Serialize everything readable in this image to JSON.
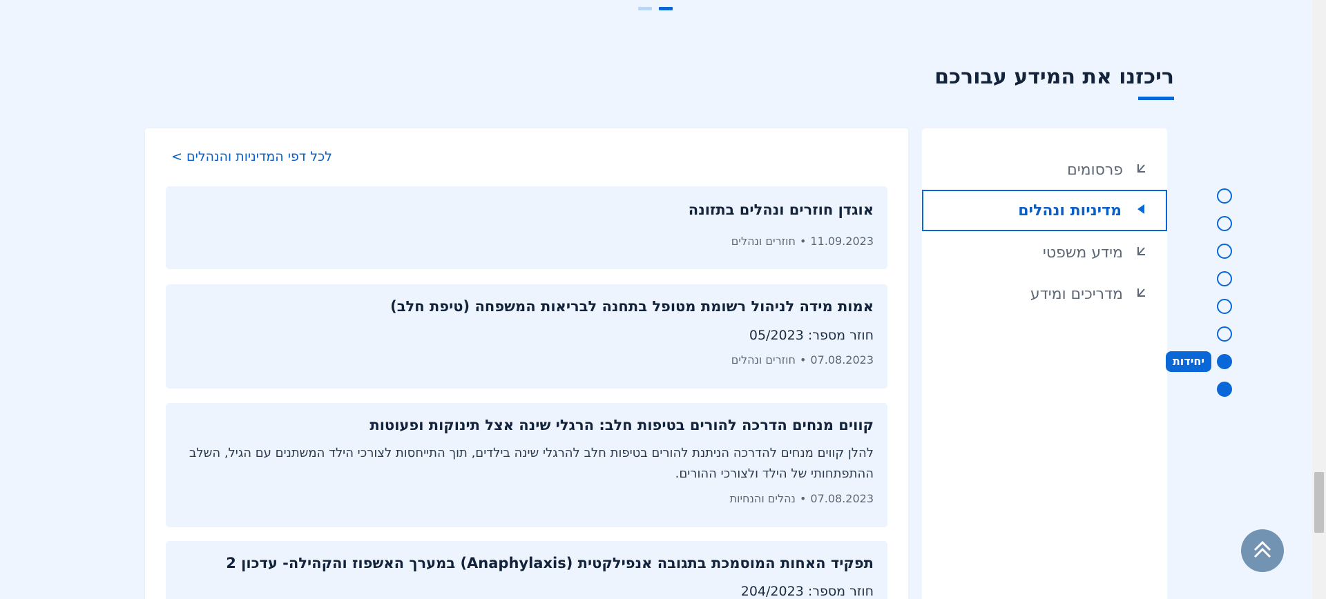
{
  "carousel": {
    "pages": 2,
    "active_index": 1
  },
  "section": {
    "title": "ריכזנו את המידע עבורכם"
  },
  "content": {
    "all_link": "לכל דפי המדיניות והנהלים >",
    "cards": [
      {
        "title": "אוגדן חוזרים ונהלים בתזונה",
        "date": "11.09.2023",
        "category": "חוזרים ונהלים"
      },
      {
        "title": "אמות מידה לניהול רשומת מטופל בתחנה לבריאות המשפחה (טיפת חלב)",
        "subtitle": "חוזר מספר: 05/2023",
        "date": "07.08.2023",
        "category": "חוזרים ונהלים"
      },
      {
        "title": "קווים מנחים הדרכה להורים בטיפות חלב: הרגלי שינה אצל תינוקות ופעוטות",
        "description": "להלן קווים מנחים להדרכה הניתנת להורים בטיפות חלב להרגלי שינה בילדים, תוך התייחסות לצורכי הילד המשתנים עם הגיל, השלב ההתפתחותי של הילד ולצורכי ההורים.",
        "date": "07.08.2023",
        "category": "נהלים והנחיות"
      },
      {
        "title": "תפקיד האחות המוסמכת בתגובה אנפילקטית (Anaphylaxis) במערך האשפוז והקהילה- עדכון 2",
        "subtitle": "חוזר מספר: 204/2023"
      }
    ]
  },
  "side_menu": {
    "items": [
      {
        "label": "פרסומים",
        "active": false
      },
      {
        "label": "מדיניות ונהלים",
        "active": true
      },
      {
        "label": "מידע משפטי",
        "active": false
      },
      {
        "label": "מדריכים ומידע",
        "active": false
      }
    ]
  },
  "page_nav": {
    "badge_label": "יחידות",
    "dots": 8
  },
  "icons": {
    "menu_arrow": "chevron-corner-icon",
    "active_arrow": "triangle-left-icon",
    "back_to_top": "double-chevron-up-icon"
  },
  "colors": {
    "accent": "#0a67d8",
    "background": "#eef5fe",
    "card": "#edf4fd"
  }
}
